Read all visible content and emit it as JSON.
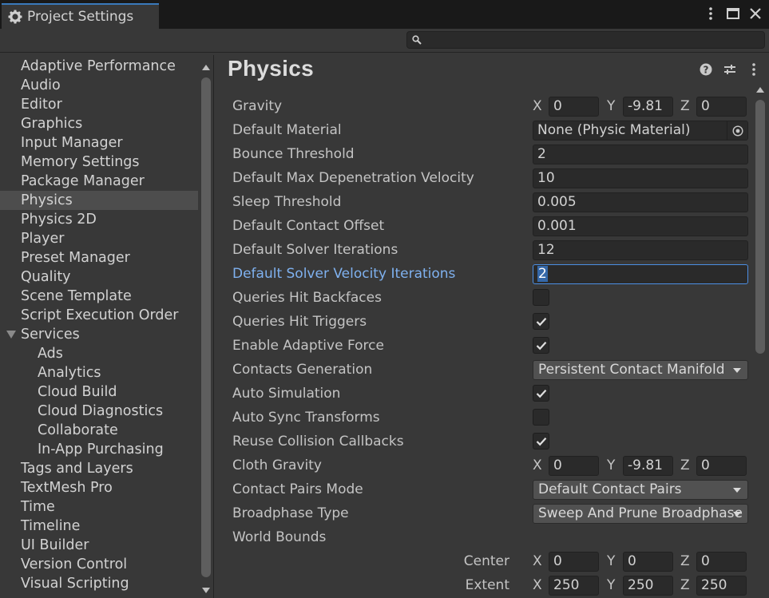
{
  "window": {
    "tab_title": "Project Settings",
    "title_icons": [
      "more-icon",
      "maximize-icon",
      "close-icon"
    ]
  },
  "search": {
    "placeholder": ""
  },
  "sidebar": {
    "items": [
      {
        "label": "Adaptive Performance"
      },
      {
        "label": "Audio"
      },
      {
        "label": "Editor"
      },
      {
        "label": "Graphics"
      },
      {
        "label": "Input Manager"
      },
      {
        "label": "Memory Settings"
      },
      {
        "label": "Package Manager"
      },
      {
        "label": "Physics",
        "selected": true
      },
      {
        "label": "Physics 2D"
      },
      {
        "label": "Player"
      },
      {
        "label": "Preset Manager"
      },
      {
        "label": "Quality"
      },
      {
        "label": "Scene Template"
      },
      {
        "label": "Script Execution Order"
      },
      {
        "label": "Services",
        "expanded": true
      },
      {
        "label": "Ads",
        "child": true
      },
      {
        "label": "Analytics",
        "child": true
      },
      {
        "label": "Cloud Build",
        "child": true
      },
      {
        "label": "Cloud Diagnostics",
        "child": true
      },
      {
        "label": "Collaborate",
        "child": true
      },
      {
        "label": "In-App Purchasing",
        "child": true
      },
      {
        "label": "Tags and Layers"
      },
      {
        "label": "TextMesh Pro"
      },
      {
        "label": "Time"
      },
      {
        "label": "Timeline"
      },
      {
        "label": "UI Builder"
      },
      {
        "label": "Version Control"
      },
      {
        "label": "Visual Scripting"
      }
    ]
  },
  "main": {
    "title": "Physics",
    "header_icons": [
      "help-icon",
      "preset-sliders-icon",
      "more-icon"
    ],
    "gravity": {
      "label": "Gravity",
      "x_label": "X",
      "x": "0",
      "y_label": "Y",
      "y": "-9.81",
      "z_label": "Z",
      "z": "0"
    },
    "default_material": {
      "label": "Default Material",
      "value": "None (Physic Material)"
    },
    "bounce_threshold": {
      "label": "Bounce Threshold",
      "value": "2"
    },
    "max_depenetration": {
      "label": "Default Max Depenetration Velocity",
      "value": "10"
    },
    "sleep_threshold": {
      "label": "Sleep Threshold",
      "value": "0.005"
    },
    "contact_offset": {
      "label": "Default Contact Offset",
      "value": "0.001"
    },
    "solver_iterations": {
      "label": "Default Solver Iterations",
      "value": "12"
    },
    "solver_velocity_iterations": {
      "label": "Default Solver Velocity Iterations",
      "value": "2"
    },
    "queries_hit_backfaces": {
      "label": "Queries Hit Backfaces",
      "checked": false
    },
    "queries_hit_triggers": {
      "label": "Queries Hit Triggers",
      "checked": true
    },
    "enable_adaptive_force": {
      "label": "Enable Adaptive Force",
      "checked": true
    },
    "contacts_generation": {
      "label": "Contacts Generation",
      "value": "Persistent Contact Manifold"
    },
    "auto_simulation": {
      "label": "Auto Simulation",
      "checked": true
    },
    "auto_sync_transforms": {
      "label": "Auto Sync Transforms",
      "checked": false
    },
    "reuse_collision_callbacks": {
      "label": "Reuse Collision Callbacks",
      "checked": true
    },
    "cloth_gravity": {
      "label": "Cloth Gravity",
      "x_label": "X",
      "x": "0",
      "y_label": "Y",
      "y": "-9.81",
      "z_label": "Z",
      "z": "0"
    },
    "contact_pairs_mode": {
      "label": "Contact Pairs Mode",
      "value": "Default Contact Pairs"
    },
    "broadphase_type": {
      "label": "Broadphase Type",
      "value": "Sweep And Prune Broadphase"
    },
    "world_bounds": {
      "label": "World Bounds",
      "center": {
        "label": "Center",
        "x_label": "X",
        "x": "0",
        "y_label": "Y",
        "y": "0",
        "z_label": "Z",
        "z": "0"
      },
      "extent": {
        "label": "Extent",
        "x_label": "X",
        "x": "250",
        "y_label": "Y",
        "y": "250",
        "z_label": "Z",
        "z": "250"
      }
    }
  }
}
